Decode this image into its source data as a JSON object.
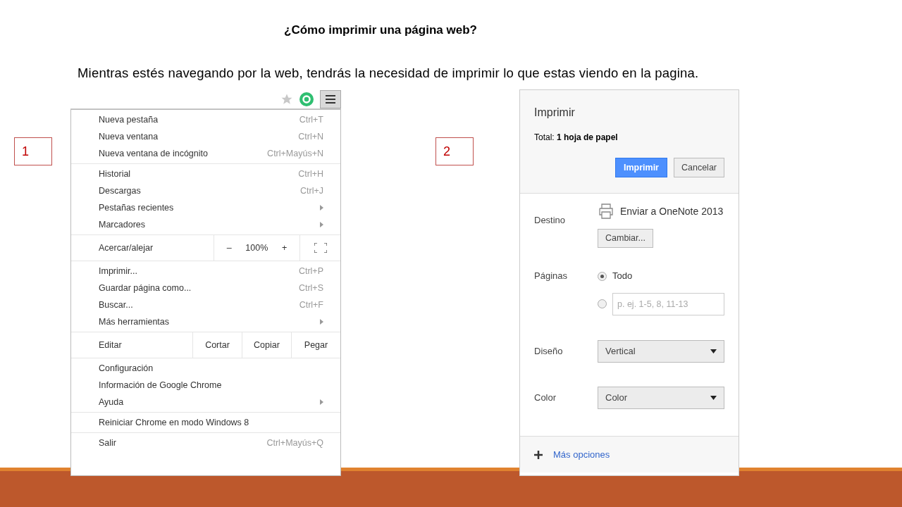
{
  "title": "¿Cómo imprimir una página web?",
  "subtitle": "Mientras estés navegando por la web, tendrás la necesidad de imprimir lo que estas viendo en la pagina.",
  "steps": [
    {
      "label": "1"
    },
    {
      "label": "2"
    }
  ],
  "menu": {
    "sections": [
      [
        {
          "kind": "item",
          "label": "Nueva pestaña",
          "shortcut": "Ctrl+T",
          "submenu": false
        },
        {
          "kind": "item",
          "label": "Nueva ventana",
          "shortcut": "Ctrl+N",
          "submenu": false
        },
        {
          "kind": "item",
          "label": "Nueva ventana de incógnito",
          "shortcut": "Ctrl+Mayús+N",
          "submenu": false
        }
      ],
      [
        {
          "kind": "item",
          "label": "Historial",
          "shortcut": "Ctrl+H",
          "submenu": false
        },
        {
          "kind": "item",
          "label": "Descargas",
          "shortcut": "Ctrl+J",
          "submenu": false
        },
        {
          "kind": "item",
          "label": "Pestañas recientes",
          "submenu": true
        },
        {
          "kind": "item",
          "label": "Marcadores",
          "submenu": true
        }
      ],
      [
        {
          "kind": "zoom",
          "label": "Acercar/alejar",
          "minus": "–",
          "value": "100%",
          "plus": "+"
        }
      ],
      [
        {
          "kind": "item",
          "label": "Imprimir...",
          "shortcut": "Ctrl+P",
          "submenu": false
        },
        {
          "kind": "item",
          "label": "Guardar página como...",
          "shortcut": "Ctrl+S",
          "submenu": false
        },
        {
          "kind": "item",
          "label": "Buscar...",
          "shortcut": "Ctrl+F",
          "submenu": false
        },
        {
          "kind": "item",
          "label": "Más herramientas",
          "submenu": true
        }
      ],
      [
        {
          "kind": "edit",
          "label": "Editar",
          "buttons": [
            "Cortar",
            "Copiar",
            "Pegar"
          ]
        }
      ],
      [
        {
          "kind": "item",
          "label": "Configuración",
          "submenu": false
        },
        {
          "kind": "item",
          "label": "Información de Google Chrome",
          "submenu": false
        },
        {
          "kind": "item",
          "label": "Ayuda",
          "submenu": true
        }
      ],
      [
        {
          "kind": "item",
          "label": "Reiniciar Chrome en modo Windows 8",
          "submenu": false
        }
      ],
      [
        {
          "kind": "item",
          "label": "Salir",
          "shortcut": "Ctrl+Mayús+Q",
          "submenu": false
        }
      ]
    ]
  },
  "dialog": {
    "title": "Imprimir",
    "total": "Total: **1 hoja de papel**",
    "print_button": "Imprimir",
    "cancel_button": "Cancelar",
    "destination": {
      "label": "Destino",
      "printer": "Enviar a OneNote 2013",
      "change_button": "Cambiar..."
    },
    "pages": {
      "label": "Páginas",
      "options": [
        {
          "label": "Todo",
          "selected": true
        },
        {
          "placeholder": "p. ej. 1-5, 8, 11-13",
          "selected": false
        }
      ]
    },
    "layout": {
      "label": "Diseño",
      "value": "Vertical"
    },
    "color": {
      "label": "Color",
      "value": "Color"
    },
    "more_options": "Más opciones"
  }
}
